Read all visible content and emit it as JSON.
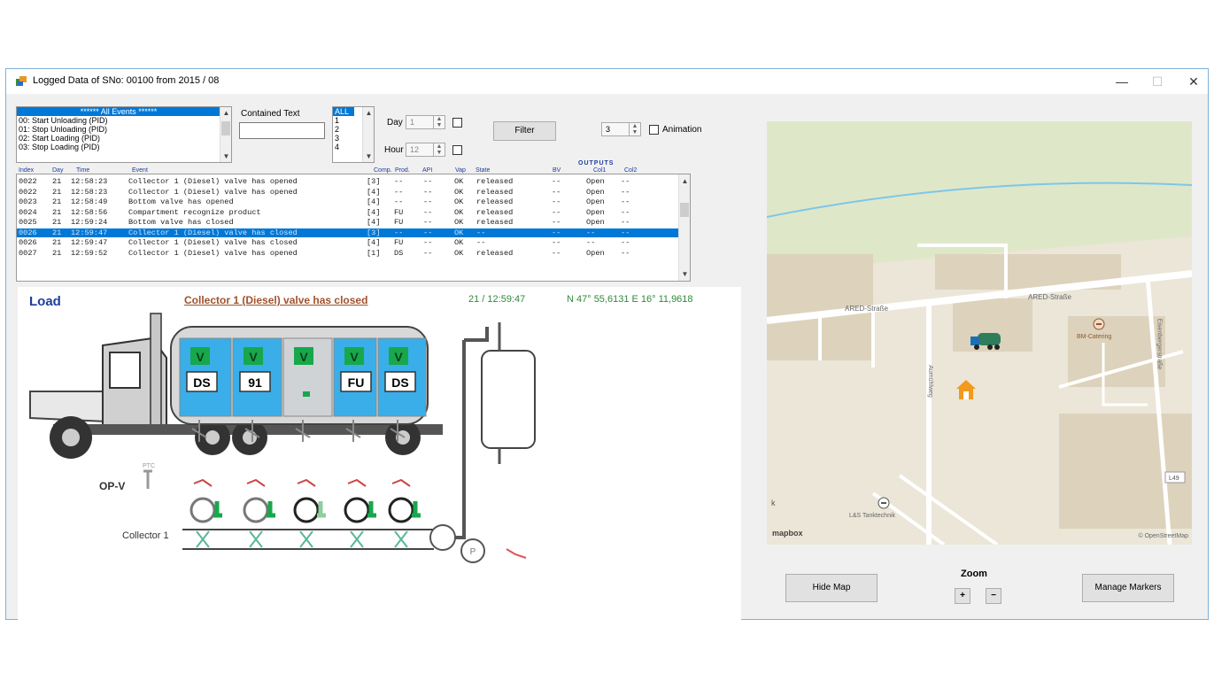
{
  "window": {
    "title": "Logged Data of SNo: 00100 from 2015 / 08",
    "minimize": "—",
    "maximize": "☐",
    "close": "✕"
  },
  "filters": {
    "events": [
      "****** All Events ******",
      "00: Start Unloading (PID)",
      "01: Stop Unloading (PID)",
      "02: Start Loading (PID)",
      "03: Stop Loading (PID)"
    ],
    "contained_text_label": "Contained Text",
    "contained_text_value": "",
    "compartments": [
      "ALL",
      "1",
      "2",
      "3",
      "4"
    ],
    "day_label": "Day",
    "day_value": "1",
    "hour_label": "Hour",
    "hour_value": "12",
    "filter_button": "Filter",
    "speed_value": "3",
    "animation_label": "Animation"
  },
  "table": {
    "outputs_label": "OUTPUTS",
    "columns": [
      "Index",
      "Day",
      "Time",
      "Event",
      "Comp.",
      "Prod.",
      "API",
      "Vap",
      "State",
      "BV",
      "Col1",
      "Col2"
    ],
    "rows": [
      [
        "0022",
        "21",
        "12:58:23",
        "Collector 1 (Diesel) valve has opened",
        "[3]",
        "--",
        "--",
        "OK",
        "released",
        "--",
        "Open",
        "--"
      ],
      [
        "0022",
        "21",
        "12:58:23",
        "Collector 1 (Diesel) valve has opened",
        "[4]",
        "--",
        "--",
        "OK",
        "released",
        "--",
        "Open",
        "--"
      ],
      [
        "0023",
        "21",
        "12:58:49",
        "Bottom valve has opened",
        "[4]",
        "--",
        "--",
        "OK",
        "released",
        "--",
        "Open",
        "--"
      ],
      [
        "0024",
        "21",
        "12:58:56",
        "Compartment recognize product",
        "[4]",
        "FU",
        "--",
        "OK",
        "released",
        "--",
        "Open",
        "--"
      ],
      [
        "0025",
        "21",
        "12:59:24",
        "Bottom valve has closed",
        "[4]",
        "FU",
        "--",
        "OK",
        "released",
        "--",
        "Open",
        "--"
      ],
      [
        "0026",
        "21",
        "12:59:47",
        "Collector 1 (Diesel) valve has closed",
        "[3]",
        "--",
        "--",
        "OK",
        "--",
        "--",
        "--",
        "--"
      ],
      [
        "0026",
        "21",
        "12:59:47",
        "Collector 1 (Diesel) valve has closed",
        "[4]",
        "FU",
        "--",
        "OK",
        "--",
        "--",
        "--",
        "--"
      ],
      [
        "0027",
        "21",
        "12:59:52",
        "Collector 1 (Diesel) valve has opened",
        "[1]",
        "DS",
        "--",
        "OK",
        "released",
        "--",
        "Open",
        "--"
      ]
    ],
    "selected_row": 5
  },
  "status": {
    "mode": "Load",
    "event": "Collector 1 (Diesel) valve has closed",
    "timestamp": "21 / 12:59:47",
    "coordinates": "N 47° 55,6131  E 16° 11,9618"
  },
  "tanker": {
    "compartments": [
      {
        "valve": "V",
        "product": "DS"
      },
      {
        "valve": "V",
        "product": "91"
      },
      {
        "valve": "V",
        "product": ""
      },
      {
        "valve": "V",
        "product": "FU"
      },
      {
        "valve": "V",
        "product": "DS"
      }
    ],
    "opv_label": "OP-V",
    "ptc_label": "PTC",
    "collector_label": "Collector 1",
    "pump_label": "P"
  },
  "map": {
    "street_1": "ARED-Straße",
    "street_2": "ARED-Straße",
    "street_3": "Aumühlweg",
    "street_4": "Eisenbergerstraße",
    "poi_1": "BM-Catering",
    "poi_2": "L&S Tanktechnik",
    "road_badge": "L49",
    "edge_letter": "k",
    "logo": "mapbox",
    "attribution": "© OpenStreetMap"
  },
  "controls": {
    "hide_map": "Hide Map",
    "zoom_label": "Zoom",
    "zoom_in": "+",
    "zoom_out": "−",
    "manage_markers": "Manage Markers"
  },
  "colors": {
    "accent": "#0078d7",
    "valve_green": "#17a84b",
    "tank_blue": "#3aaee8",
    "header_blue": "#1f3c9e",
    "status_green": "#2e8b3a",
    "event_brown": "#a0522d"
  }
}
